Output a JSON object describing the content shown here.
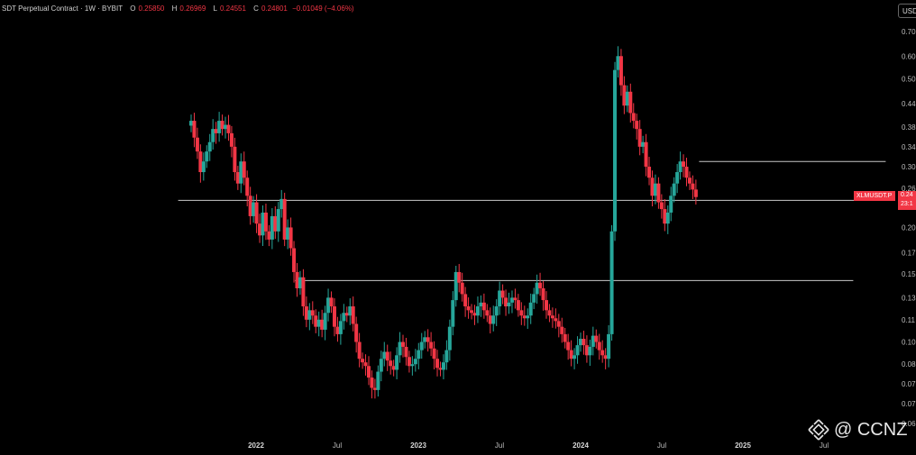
{
  "header": {
    "symbol": "SDT Perpetual Contract · 1W · BYBIT",
    "open_label": "O",
    "open": "0.25850",
    "high_label": "H",
    "high": "0.26969",
    "low_label": "L",
    "low": "0.24551",
    "close_label": "C",
    "close": "0.24801",
    "change": "−0.01049 (−4.06%)"
  },
  "currency_button": "USD",
  "symbol_tag": "XLMUSDT.P",
  "last_price": "0.24",
  "countdown": "23:1",
  "watermark": "@ CCNZ",
  "colors": {
    "up": "#26a69a",
    "down": "#f23645",
    "background": "#000000",
    "hline": "#c8c8c8"
  },
  "chart_data": {
    "type": "candlestick",
    "symbol": "XLMUSDT.P",
    "timeframe": "1W",
    "y_scale": "log",
    "y_ticks": [
      "0.70",
      "0.60",
      "0.50",
      "0.44",
      "0.38",
      "0.34",
      "0.30",
      "0.26",
      "0.20",
      "0.17",
      "0.15",
      "0.13",
      "0.11",
      "0.10",
      "0.08",
      "0.07",
      "0.07",
      "0.06"
    ],
    "y_tick_values": [
      0.7,
      0.6,
      0.52,
      0.445,
      0.385,
      0.34,
      0.3,
      0.262,
      0.205,
      0.175,
      0.153,
      0.132,
      0.115,
      0.1,
      0.087,
      0.077,
      0.068,
      0.06
    ],
    "x_ticks": [
      {
        "label": "2022",
        "t": 2022.0,
        "bold": true
      },
      {
        "label": "Jul",
        "t": 2022.5,
        "bold": false
      },
      {
        "label": "2023",
        "t": 2023.0,
        "bold": true
      },
      {
        "label": "Jul",
        "t": 2023.5,
        "bold": false
      },
      {
        "label": "2024",
        "t": 2024.0,
        "bold": true
      },
      {
        "label": "Jul",
        "t": 2024.5,
        "bold": false
      },
      {
        "label": "2025",
        "t": 2025.0,
        "bold": true
      },
      {
        "label": "Jul",
        "t": 2025.5,
        "bold": false
      }
    ],
    "x_range": [
      2021.3,
      2025.95
    ],
    "y_range": [
      0.06,
      0.72
    ],
    "horizontal_lines": [
      {
        "price": 0.31,
        "from": 2024.73,
        "to": 2025.88
      },
      {
        "price": 0.243,
        "from": 2021.52,
        "to": 2025.88
      },
      {
        "price": 0.147,
        "from": 2022.24,
        "to": 2025.68
      }
    ],
    "close_series": [
      {
        "start": 2021.6,
        "step": 0.0192,
        "closes": [
          0.4,
          0.36,
          0.33,
          0.29,
          0.31,
          0.33,
          0.35,
          0.38,
          0.37,
          0.4,
          0.38,
          0.39,
          0.37,
          0.34,
          0.29,
          0.27,
          0.31,
          0.28,
          0.25,
          0.22,
          0.24,
          0.21,
          0.195,
          0.225,
          0.2,
          0.19,
          0.22,
          0.2,
          0.23,
          0.245,
          0.19,
          0.205,
          0.18,
          0.155,
          0.14,
          0.15,
          0.125,
          0.115,
          0.122,
          0.118,
          0.11,
          0.115,
          0.108,
          0.12,
          0.132,
          0.125,
          0.11,
          0.105,
          0.114,
          0.12,
          0.118,
          0.125,
          0.112,
          0.1,
          0.09,
          0.088,
          0.086,
          0.08,
          0.075,
          0.074,
          0.083,
          0.09,
          0.094,
          0.089,
          0.086,
          0.084,
          0.092,
          0.1,
          0.097,
          0.091,
          0.086,
          0.087,
          0.09,
          0.095,
          0.1,
          0.103,
          0.1,
          0.096,
          0.09,
          0.085,
          0.084,
          0.088,
          0.095,
          0.11,
          0.13,
          0.155,
          0.145,
          0.135,
          0.125,
          0.122,
          0.12,
          0.118,
          0.125,
          0.128,
          0.122,
          0.118,
          0.112,
          0.118,
          0.125,
          0.138,
          0.132,
          0.125,
          0.128,
          0.132,
          0.13,
          0.122,
          0.118,
          0.116,
          0.118,
          0.128,
          0.135,
          0.145,
          0.14,
          0.13,
          0.122,
          0.118,
          0.116,
          0.114,
          0.11,
          0.105,
          0.1,
          0.095,
          0.09,
          0.092,
          0.098,
          0.102,
          0.098,
          0.092,
          0.097,
          0.104,
          0.1,
          0.095,
          0.092,
          0.09,
          0.105,
          0.2,
          0.55,
          0.6,
          0.5,
          0.44,
          0.48,
          0.42,
          0.4,
          0.38,
          0.34,
          0.35,
          0.3,
          0.28,
          0.25,
          0.27,
          0.24,
          0.23,
          0.21,
          0.225,
          0.25,
          0.27,
          0.29,
          0.31,
          0.3,
          0.28,
          0.27,
          0.26,
          0.24801
        ]
      }
    ]
  }
}
